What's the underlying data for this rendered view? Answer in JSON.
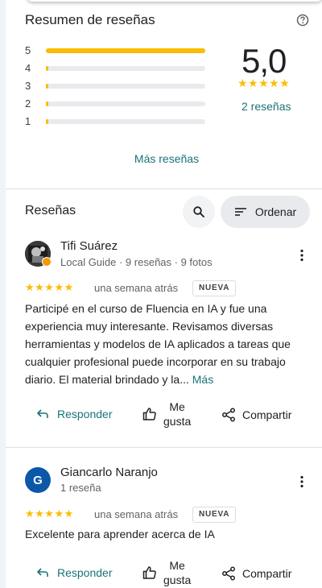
{
  "summary": {
    "title": "Resumen de reseñas",
    "bars": [
      {
        "label": "5",
        "fraction": 1.0
      },
      {
        "label": "4",
        "fraction": 0
      },
      {
        "label": "3",
        "fraction": 0
      },
      {
        "label": "2",
        "fraction": 0
      },
      {
        "label": "1",
        "fraction": 0
      }
    ],
    "rating": "5,0",
    "stars": "★★★★★",
    "reviews_count": "2 reseñas",
    "more_reviews": "Más reseñas"
  },
  "reviews_section": {
    "title": "Reseñas",
    "sort_label": "Ordenar"
  },
  "reviews": [
    {
      "author": "Tifi Suárez",
      "meta": "Local Guide · 9 reseñas · 9 fotos",
      "stars": "★★★★★",
      "time": "una semana atrás",
      "badge": "NUEVA",
      "text": "Participé en el curso de Fluencia en IA y fue una experiencia muy interesante. Revisamos diversas herramientas y modelos de IA aplicados a tareas que cualquier profesional puede incorporar en su trabajo diario. El material brindado y la... ",
      "more": "Más",
      "reply": "Responder",
      "like_line1": "Me",
      "like_line2": "gusta",
      "share": "Compartir"
    },
    {
      "author": "Giancarlo Naranjo",
      "avatar_letter": "G",
      "meta": "1 reseña",
      "stars": "★★★★★",
      "time": "una semana atrás",
      "badge": "NUEVA",
      "text": "Excelente para aprender acerca de IA",
      "reply": "Responder",
      "like_line1": "Me",
      "like_line2": "gusta",
      "share": "Compartir"
    }
  ],
  "colors": {
    "accent": "#1a7377",
    "star": "#fbbc04",
    "avatar_blue": "#0b57a8"
  }
}
